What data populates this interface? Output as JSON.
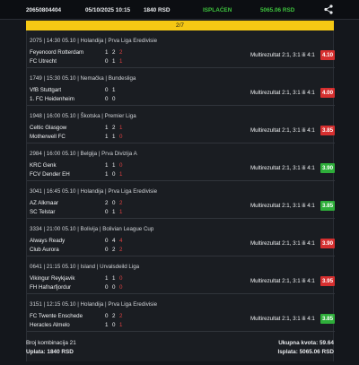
{
  "ticket": {
    "id": "20650804404",
    "date": "05/10/2025 10:15",
    "stake": "1840 RSD",
    "status": "ISPLAĆEN",
    "payout": "5065.06 RSD",
    "status_color": "#3ec23e"
  },
  "combination_bar": "2/7",
  "matches": [
    {
      "header": "2075 | 14:30 05.10 | Holandija | Prva Liga Eredivisie",
      "home": "Feyenoord Rotterdam",
      "away": "FC Utrecht",
      "home_h1": "1",
      "home_h2": "2",
      "home_h3": "2",
      "away_h1": "0",
      "away_h2": "1",
      "away_h3": "1",
      "pick": "Multirezultat 2:1, 3:1 ili 4:1",
      "odd": "4.10",
      "result": "lose"
    },
    {
      "header": "1749 | 15:30 05.10 | Nemačka | Bundesliga",
      "home": "VfB Stuttgart",
      "away": "1. FC Heidenheim",
      "home_h1": "0",
      "home_h2": "1",
      "home_h3": "",
      "away_h1": "0",
      "away_h2": "0",
      "away_h3": "",
      "pick": "Multirezultat 2:1, 3:1 ili 4:1",
      "odd": "4.00",
      "result": "lose"
    },
    {
      "header": "1948 | 16:00 05.10 | Škotska | Premier Liga",
      "home": "Celtic Glasgow",
      "away": "Motherwell FC",
      "home_h1": "1",
      "home_h2": "2",
      "home_h3": "1",
      "away_h1": "1",
      "away_h2": "1",
      "away_h3": "0",
      "pick": "Multirezultat 2:1, 3:1 ili 4:1",
      "odd": "3.85",
      "result": "lose"
    },
    {
      "header": "2984 | 16:00 05.10 | Belgija | Prva Divizija A",
      "home": "KRC Genk",
      "away": "FCV Dender EH",
      "home_h1": "1",
      "home_h2": "1",
      "home_h3": "0",
      "away_h1": "1",
      "away_h2": "0",
      "away_h3": "1",
      "pick": "Multirezultat 2:1, 3:1 ili 4:1",
      "odd": "3.90",
      "result": "win"
    },
    {
      "header": "3041 | 16:45 05.10 | Holandija | Prva Liga Eredivisie",
      "home": "AZ Alkmaar",
      "away": "SC Telstar",
      "home_h1": "2",
      "home_h2": "0",
      "home_h3": "2",
      "away_h1": "0",
      "away_h2": "1",
      "away_h3": "1",
      "pick": "Multirezultat 2:1, 3:1 ili 4:1",
      "odd": "3.85",
      "result": "win"
    },
    {
      "header": "3334 | 21:00 05.10 | Bolivija | Bolivian League Cup",
      "home": "Always Ready",
      "away": "Club Aurora",
      "home_h1": "0",
      "home_h2": "4",
      "home_h3": "4",
      "away_h1": "0",
      "away_h2": "2",
      "away_h3": "2",
      "pick": "Multirezultat 2:1, 3:1 ili 4:1",
      "odd": "3.90",
      "result": "lose"
    },
    {
      "header": "0641 | 21:15 05.10 | Island | Urvalsdeild Liga",
      "home": "Vikingur Reykjavik",
      "away": "FH Hafnarfjordur",
      "home_h1": "1",
      "home_h2": "1",
      "home_h3": "0",
      "away_h1": "0",
      "away_h2": "0",
      "away_h3": "0",
      "pick": "Multirezultat 2:1, 3:1 ili 4:1",
      "odd": "3.95",
      "result": "lose"
    },
    {
      "header": "3151 | 12:15 05.10 | Holandija | Prva Liga Eredivisie",
      "home": "FC Twente Enschede",
      "away": "Heracles Almelo",
      "home_h1": "0",
      "home_h2": "2",
      "home_h3": "2",
      "away_h1": "1",
      "away_h2": "0",
      "away_h3": "1",
      "pick": "Multirezultat 2:1, 3:1 ili 4:1",
      "odd": "3.85",
      "result": "win"
    }
  ],
  "footer": {
    "combinations": "Broj kombinacija 21",
    "stake": "Uplata: 1840 RSD",
    "total_odds": "Ukupna kvota: 59.64",
    "payout": "Isplata: 5065.06 RSD"
  },
  "icons": {
    "share": "share-icon"
  },
  "colors": {
    "accent_yellow": "#f5c814",
    "win_green": "#2eae3a",
    "lose_red": "#d62f2f"
  }
}
